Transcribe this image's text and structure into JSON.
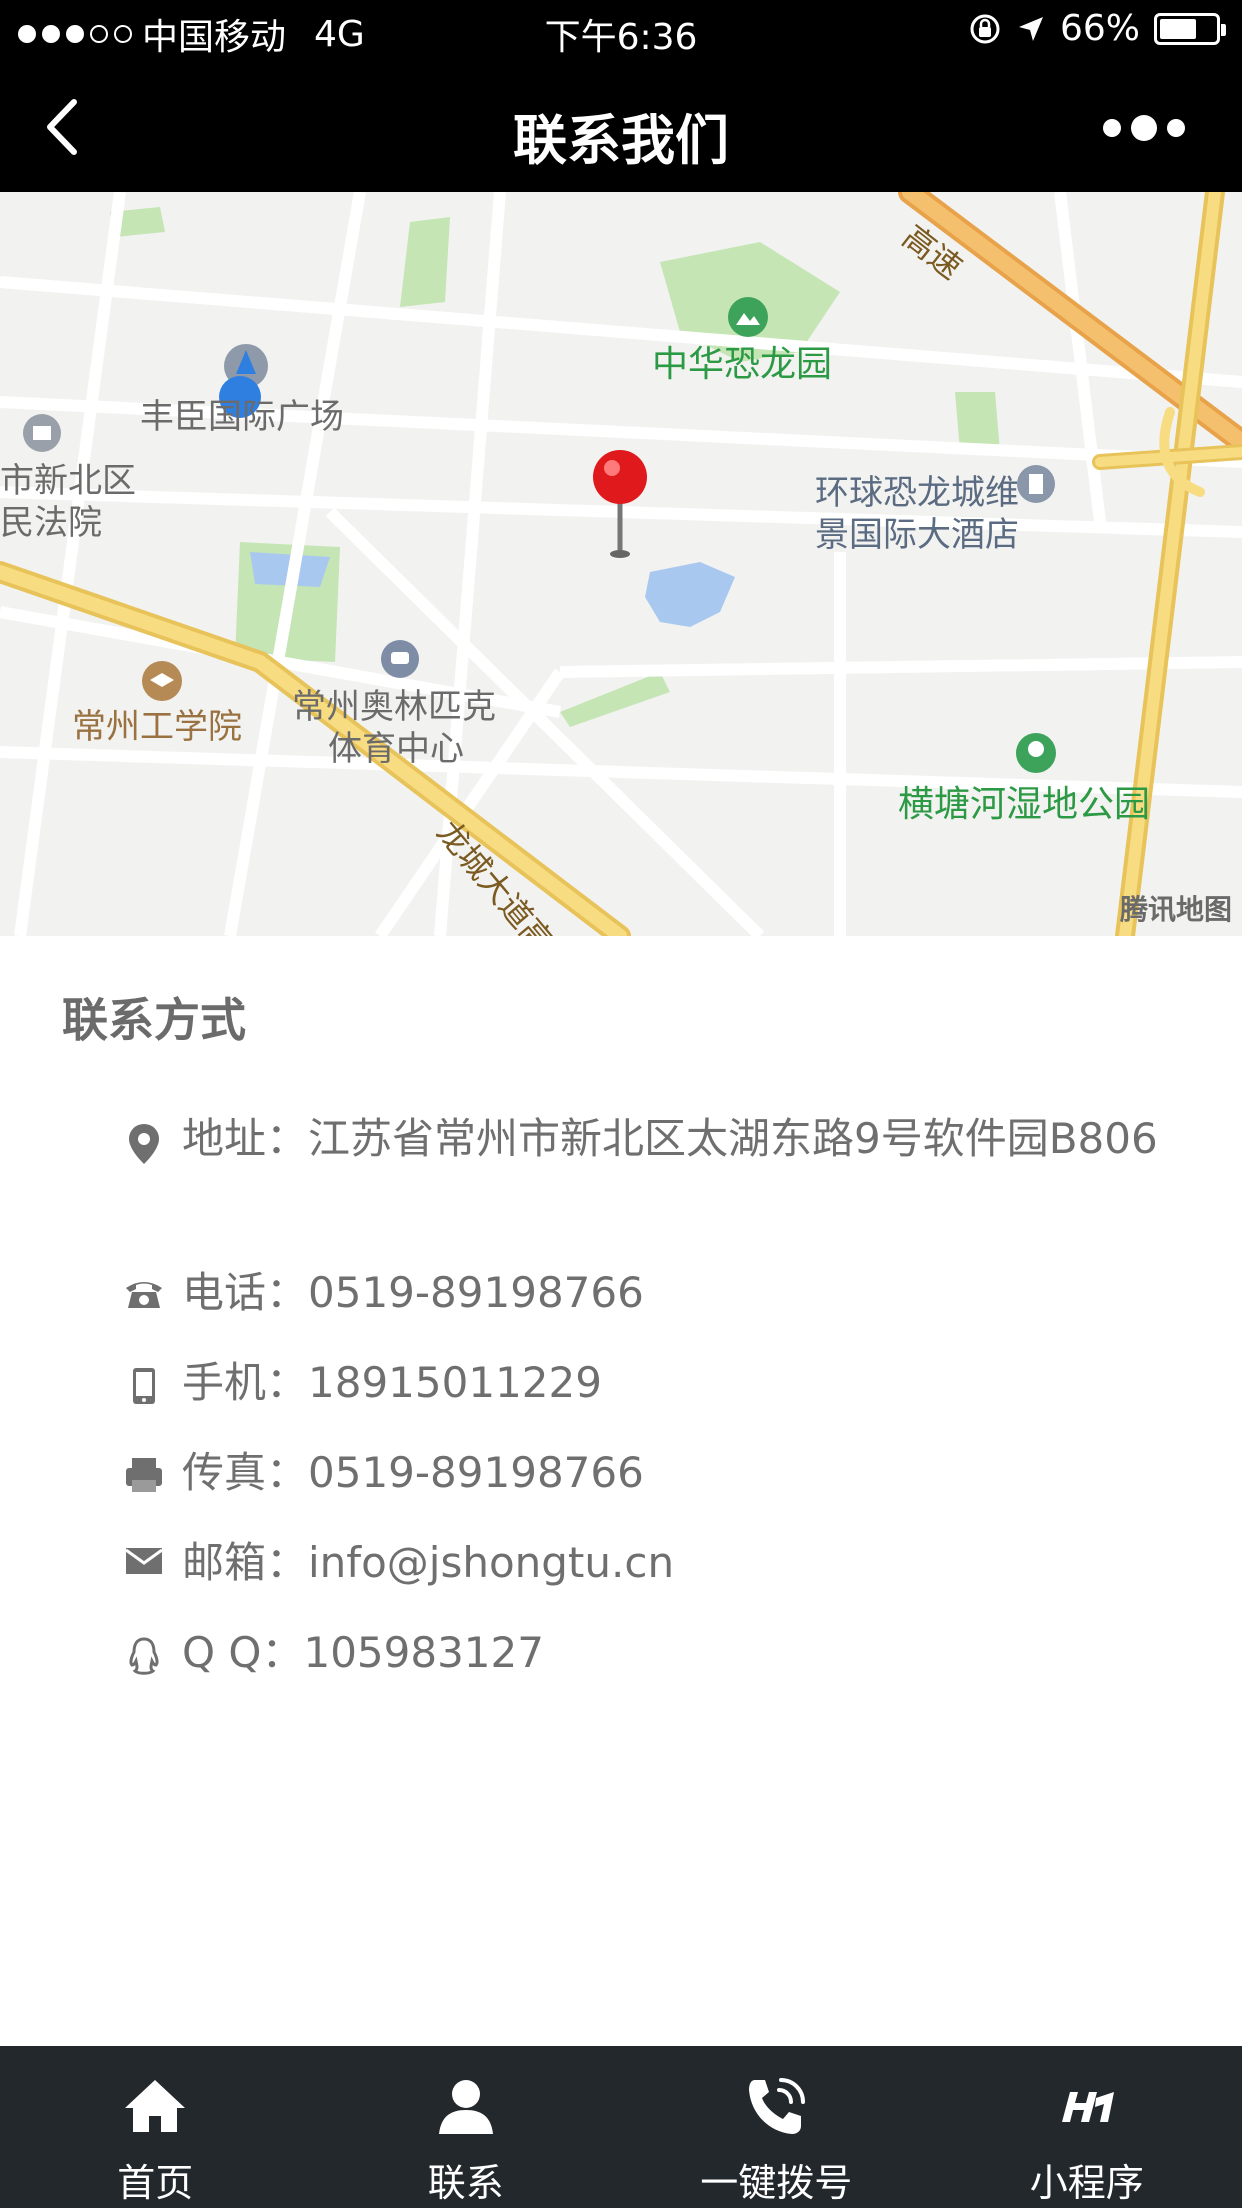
{
  "status_bar": {
    "carrier": "中国移动",
    "network": "4G",
    "time": "下午6:36",
    "battery_text": "66%",
    "battery_level": 0.66
  },
  "nav": {
    "title": "联系我们"
  },
  "map": {
    "provider": "腾讯地图",
    "labels": {
      "dinosaur_park": "中华恐龙园",
      "fengchen_plaza": "丰臣国际广场",
      "court_line1": "市新北区",
      "court_line2": "民法院",
      "hotel_line1": "环球恐龙城维",
      "hotel_line2": "景国际大酒店",
      "institute": "常州工学院",
      "olympic_line1": "常州奥林匹克",
      "olympic_line2": "体育中心",
      "wetland_park": "横塘河湿地公园",
      "highway": "高速",
      "longcheng_road": "龙城大道高"
    }
  },
  "contact": {
    "title": "联系方式",
    "address_label": "地址：",
    "address_value": "江苏省常州市新北区太湖东路9号软件园B806",
    "phone_label": "电话：",
    "phone_value": "0519-89198766",
    "mobile_label": "手机：",
    "mobile_value": "18915011229",
    "fax_label": "传真：",
    "fax_value": "0519-89198766",
    "email_label": "邮箱：",
    "email_value": "info@jshongtu.cn",
    "qq_label": "Q Q：",
    "qq_value": "105983127"
  },
  "tabs": [
    {
      "label": "首页",
      "icon": "home-icon"
    },
    {
      "label": "联系",
      "icon": "person-icon"
    },
    {
      "label": "一键拨号",
      "icon": "phone-call-icon"
    },
    {
      "label": "小程序",
      "icon": "mini-program-icon"
    }
  ]
}
